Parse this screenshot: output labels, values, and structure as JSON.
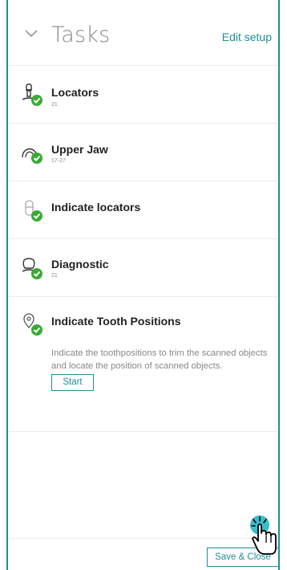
{
  "header": {
    "title": "Tasks",
    "edit_label": "Edit setup"
  },
  "tasks": [
    {
      "name": "Locators",
      "sub": "21",
      "icon": "locator-icon",
      "status": "completed"
    },
    {
      "name": "Upper Jaw",
      "sub": "17-27",
      "icon": "upper-jaw-icon",
      "status": "completed"
    },
    {
      "name": "Indicate locators",
      "sub": "",
      "icon": "indicate-locator-icon",
      "status": "completed"
    },
    {
      "name": "Diagnostic",
      "sub": "21",
      "icon": "diagnostic-tooth-icon",
      "status": "completed"
    },
    {
      "name": "Indicate Tooth Positions",
      "sub": "",
      "icon": "map-pin-icon",
      "status": "completed"
    }
  ],
  "active_task": {
    "description": "Indicate the toothpositions to trim the scanned objects and locate the position of scanned objects.",
    "start_label": "Start"
  },
  "footer": {
    "save_label": "Save & Close"
  },
  "colors": {
    "accent": "#1f8f96",
    "success": "#3aaa35",
    "border": "#1f8f96"
  }
}
